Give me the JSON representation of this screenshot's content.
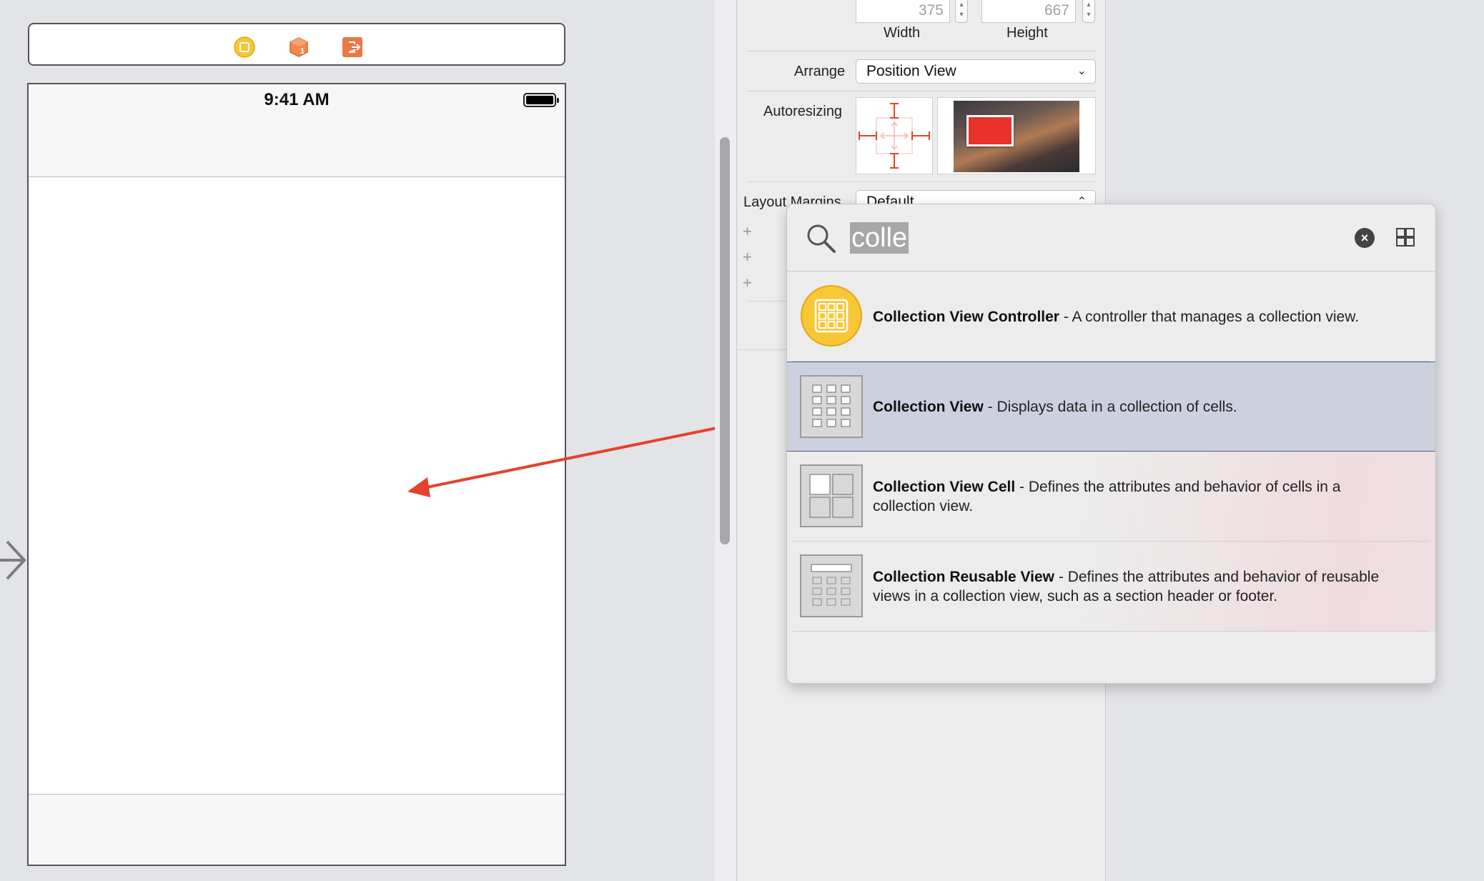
{
  "canvas": {
    "status_time": "9:41 AM",
    "dock_icons": [
      "view-controller-icon",
      "first-responder-icon",
      "exit-icon"
    ]
  },
  "inspector": {
    "width_value": "375",
    "height_value": "667",
    "width_label": "Width",
    "height_label": "Height",
    "arrange_label": "Arrange",
    "arrange_value": "Position View",
    "autoresizing_label": "Autoresizing",
    "layout_margins_label": "Layout Margins",
    "layout_margins_value": "Default"
  },
  "library": {
    "search_query": "colle",
    "items": [
      {
        "title": "Collection View Controller",
        "description": " - A controller that manages a collection view.",
        "icon": "collection-view-controller-icon",
        "selected": false
      },
      {
        "title": "Collection View",
        "description": " - Displays data in a collection of cells.",
        "icon": "collection-view-icon",
        "selected": true
      },
      {
        "title": "Collection View Cell",
        "description": " - Defines the attributes and behavior of cells in a collection view.",
        "icon": "collection-view-cell-icon",
        "selected": false
      },
      {
        "title": "Collection Reusable View",
        "description": " - Defines the attributes and behavior of reusable views in a collection view, such as a section header or footer.",
        "icon": "collection-reusable-view-icon",
        "selected": false
      }
    ]
  },
  "colors": {
    "drag_arrow": "#e5412c",
    "selection": "#cdd0de",
    "controller_yellow": "#f7c736",
    "canvas_bg": "#e3e4e8"
  }
}
